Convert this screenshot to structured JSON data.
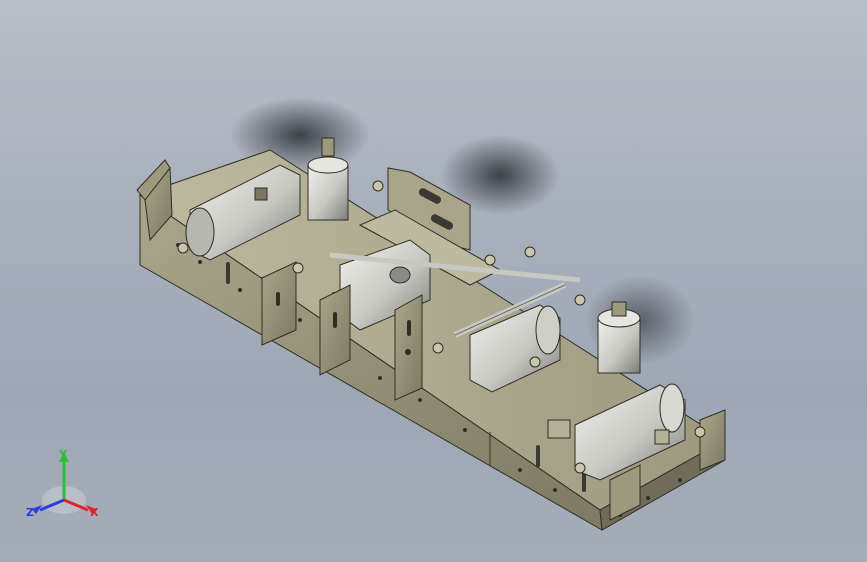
{
  "viewport": {
    "background_top": "#b9bfc8",
    "background_bottom": "#a5adb9"
  },
  "model": {
    "name": "",
    "colors": {
      "steel": "#8f8c74",
      "steel_light": "#b4b196",
      "steel_dark": "#5e5c4a",
      "cylinder": "#d4d4cf",
      "cylinder_shade": "#8a8a86",
      "edge": "#2f2e26"
    }
  },
  "triad": {
    "x_label": "X",
    "y_label": "Y",
    "z_label": "Z",
    "x_color": "#e0262b",
    "y_color": "#2cbf3a",
    "z_color": "#2b3fd6"
  }
}
